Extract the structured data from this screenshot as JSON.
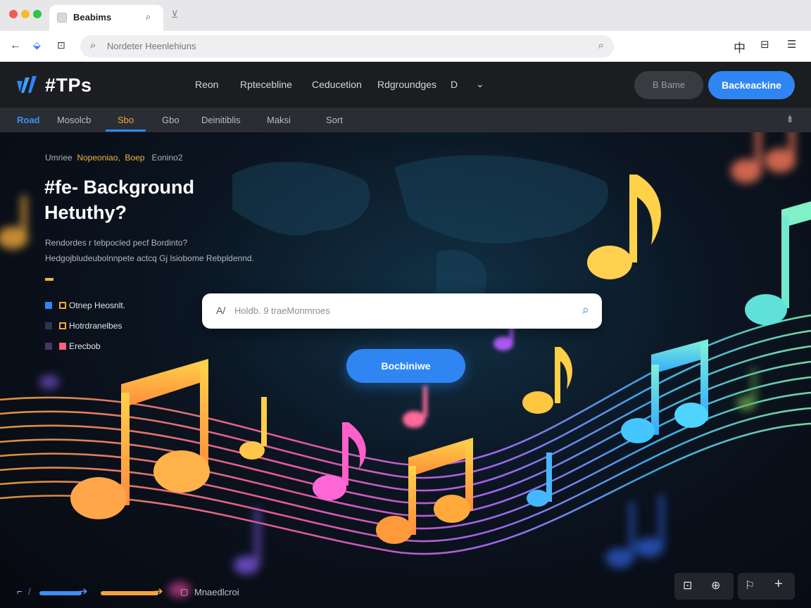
{
  "browser": {
    "tab_title": "Beabims",
    "new_tab_icon": "⌕",
    "address_placeholder": "Nordeter Heenlehiuns"
  },
  "site": {
    "logo": "#TPs",
    "nav": [
      "Reon",
      "Rptecebline",
      "Ceducetion",
      "Rdgroundges"
    ],
    "nav_extra": "D",
    "btn_ghost": "B Bame",
    "btn_primary": "Backeackine"
  },
  "subnav": {
    "tabs": [
      "Road",
      "Mosolcb",
      "Sbo",
      "Gbo",
      "Deinitiblis",
      "Maksi",
      "Sort"
    ]
  },
  "hero": {
    "crumbs": [
      "Umriee",
      "Nopeoniao,",
      "Boep",
      "Eonino2"
    ],
    "headline_line1": "#fe- Background",
    "headline_line2": "Hetuthy?",
    "desc_line1": "Rendordes r tebpocled pecf Bordinto?",
    "desc_line2": "Hedgojbludeubolnnpete actcq Gj lsiobome Rebpldennd.",
    "options": [
      {
        "label": "Otnep Heosnlt.",
        "color": "#2f86f3",
        "accent": "#f2a93b"
      },
      {
        "label": "Hotrdranelbes",
        "color": "#2a3550",
        "accent": "#f2a93b"
      },
      {
        "label": "Erecbob",
        "color": "#4a3560",
        "accent": "#ff5f7a"
      }
    ],
    "search_prefix": "A/",
    "search_placeholder": "Holdb. 9 traeMonmroes",
    "cta": "Bocbiniwe"
  },
  "footer": {
    "label": "Mnaedlcroi"
  },
  "colors": {
    "accent_blue": "#2f86f3",
    "accent_orange": "#f2b43b",
    "header_bg": "#1c1d21"
  }
}
